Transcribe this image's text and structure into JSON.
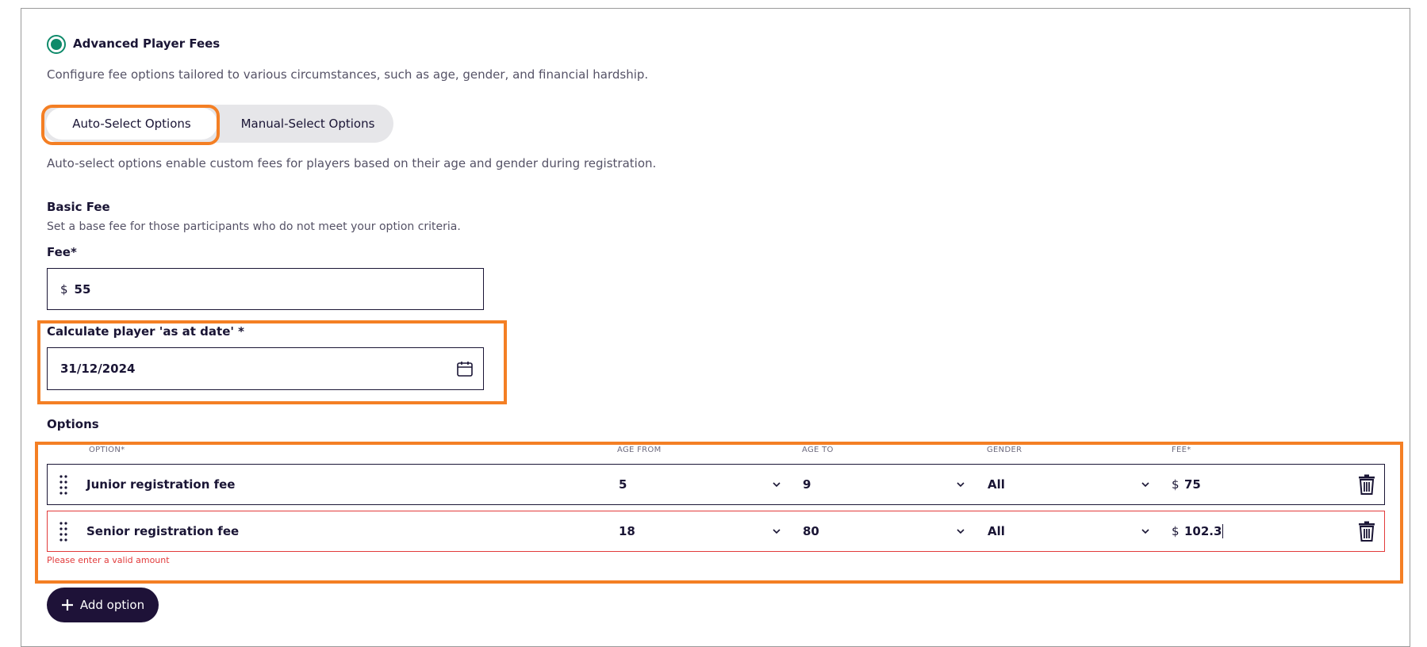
{
  "section": {
    "title": "Advanced Player Fees",
    "description": "Configure fee options tailored to various circumstances, such as age, gender, and financial hardship.",
    "tabs": [
      "Auto-Select Options",
      "Manual-Select Options"
    ],
    "tab_description": "Auto-select options enable custom fees for players based on their age and gender during registration."
  },
  "basic_fee": {
    "heading": "Basic Fee",
    "description": "Set a base fee for those participants who do not meet your option criteria.",
    "fee_label": "Fee*",
    "currency": "$",
    "fee_value": "55"
  },
  "as_at_date": {
    "label": "Calculate player 'as at date' *",
    "value": "31/12/2024"
  },
  "options": {
    "heading": "Options",
    "columns": {
      "option": "OPTION*",
      "age_from": "AGE FROM",
      "age_to": "AGE TO",
      "gender": "GENDER",
      "fee": "FEE*"
    },
    "rows": [
      {
        "name": "Junior registration fee",
        "age_from": "5",
        "age_to": "9",
        "gender": "All",
        "currency": "$",
        "fee": "75"
      },
      {
        "name": "Senior registration fee",
        "age_from": "18",
        "age_to": "80",
        "gender": "All",
        "currency": "$",
        "fee": "102.3"
      }
    ],
    "error": "Please enter a valid amount",
    "add_button": "Add option"
  },
  "colors": {
    "highlight": "#f47f24",
    "radio": "#0e8a6a",
    "primary_button": "#1e1238",
    "error": "#e23b3b"
  }
}
